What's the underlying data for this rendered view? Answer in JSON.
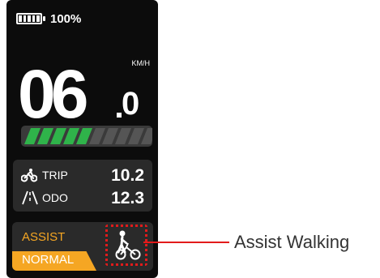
{
  "status": {
    "battery_percent": "100%",
    "battery_level": 1.0
  },
  "speed": {
    "whole": "06",
    "decimal": "0",
    "unit": "KM/H"
  },
  "assist_level_bar": {
    "segments_total": 10,
    "segments_lit": 5,
    "lit_color": "#2fb34a",
    "unlit_color": "#555555"
  },
  "trip": {
    "label": "TRIP",
    "value": "10.2",
    "icon": "bicycle-rider-icon"
  },
  "odo": {
    "label": "ODO",
    "value": "12.3",
    "icon": "road-icon"
  },
  "assist": {
    "label": "ASSIST",
    "mode": "NORMAL",
    "walk_icon": "walking-with-bicycle-icon",
    "accent": "#f5a623"
  },
  "callout": {
    "text": "Assist Walking",
    "color": "#e21b1b"
  }
}
